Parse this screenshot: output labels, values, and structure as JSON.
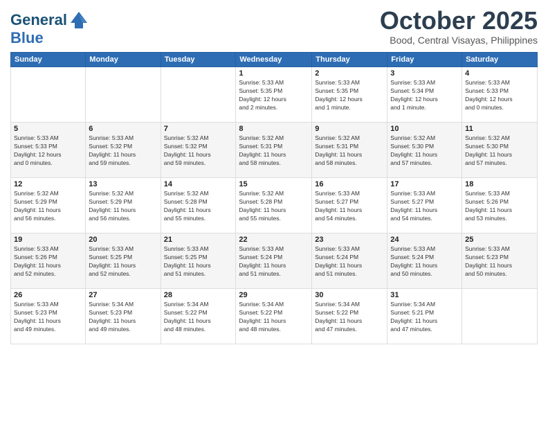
{
  "header": {
    "logo_line1": "General",
    "logo_line2": "Blue",
    "month": "October 2025",
    "location": "Bood, Central Visayas, Philippines"
  },
  "weekdays": [
    "Sunday",
    "Monday",
    "Tuesday",
    "Wednesday",
    "Thursday",
    "Friday",
    "Saturday"
  ],
  "weeks": [
    [
      {
        "day": "",
        "text": ""
      },
      {
        "day": "",
        "text": ""
      },
      {
        "day": "",
        "text": ""
      },
      {
        "day": "1",
        "text": "Sunrise: 5:33 AM\nSunset: 5:35 PM\nDaylight: 12 hours\nand 2 minutes."
      },
      {
        "day": "2",
        "text": "Sunrise: 5:33 AM\nSunset: 5:35 PM\nDaylight: 12 hours\nand 1 minute."
      },
      {
        "day": "3",
        "text": "Sunrise: 5:33 AM\nSunset: 5:34 PM\nDaylight: 12 hours\nand 1 minute."
      },
      {
        "day": "4",
        "text": "Sunrise: 5:33 AM\nSunset: 5:33 PM\nDaylight: 12 hours\nand 0 minutes."
      }
    ],
    [
      {
        "day": "5",
        "text": "Sunrise: 5:33 AM\nSunset: 5:33 PM\nDaylight: 12 hours\nand 0 minutes."
      },
      {
        "day": "6",
        "text": "Sunrise: 5:33 AM\nSunset: 5:32 PM\nDaylight: 11 hours\nand 59 minutes."
      },
      {
        "day": "7",
        "text": "Sunrise: 5:32 AM\nSunset: 5:32 PM\nDaylight: 11 hours\nand 59 minutes."
      },
      {
        "day": "8",
        "text": "Sunrise: 5:32 AM\nSunset: 5:31 PM\nDaylight: 11 hours\nand 58 minutes."
      },
      {
        "day": "9",
        "text": "Sunrise: 5:32 AM\nSunset: 5:31 PM\nDaylight: 11 hours\nand 58 minutes."
      },
      {
        "day": "10",
        "text": "Sunrise: 5:32 AM\nSunset: 5:30 PM\nDaylight: 11 hours\nand 57 minutes."
      },
      {
        "day": "11",
        "text": "Sunrise: 5:32 AM\nSunset: 5:30 PM\nDaylight: 11 hours\nand 57 minutes."
      }
    ],
    [
      {
        "day": "12",
        "text": "Sunrise: 5:32 AM\nSunset: 5:29 PM\nDaylight: 11 hours\nand 56 minutes."
      },
      {
        "day": "13",
        "text": "Sunrise: 5:32 AM\nSunset: 5:29 PM\nDaylight: 11 hours\nand 56 minutes."
      },
      {
        "day": "14",
        "text": "Sunrise: 5:32 AM\nSunset: 5:28 PM\nDaylight: 11 hours\nand 55 minutes."
      },
      {
        "day": "15",
        "text": "Sunrise: 5:32 AM\nSunset: 5:28 PM\nDaylight: 11 hours\nand 55 minutes."
      },
      {
        "day": "16",
        "text": "Sunrise: 5:33 AM\nSunset: 5:27 PM\nDaylight: 11 hours\nand 54 minutes."
      },
      {
        "day": "17",
        "text": "Sunrise: 5:33 AM\nSunset: 5:27 PM\nDaylight: 11 hours\nand 54 minutes."
      },
      {
        "day": "18",
        "text": "Sunrise: 5:33 AM\nSunset: 5:26 PM\nDaylight: 11 hours\nand 53 minutes."
      }
    ],
    [
      {
        "day": "19",
        "text": "Sunrise: 5:33 AM\nSunset: 5:26 PM\nDaylight: 11 hours\nand 52 minutes."
      },
      {
        "day": "20",
        "text": "Sunrise: 5:33 AM\nSunset: 5:25 PM\nDaylight: 11 hours\nand 52 minutes."
      },
      {
        "day": "21",
        "text": "Sunrise: 5:33 AM\nSunset: 5:25 PM\nDaylight: 11 hours\nand 51 minutes."
      },
      {
        "day": "22",
        "text": "Sunrise: 5:33 AM\nSunset: 5:24 PM\nDaylight: 11 hours\nand 51 minutes."
      },
      {
        "day": "23",
        "text": "Sunrise: 5:33 AM\nSunset: 5:24 PM\nDaylight: 11 hours\nand 51 minutes."
      },
      {
        "day": "24",
        "text": "Sunrise: 5:33 AM\nSunset: 5:24 PM\nDaylight: 11 hours\nand 50 minutes."
      },
      {
        "day": "25",
        "text": "Sunrise: 5:33 AM\nSunset: 5:23 PM\nDaylight: 11 hours\nand 50 minutes."
      }
    ],
    [
      {
        "day": "26",
        "text": "Sunrise: 5:33 AM\nSunset: 5:23 PM\nDaylight: 11 hours\nand 49 minutes."
      },
      {
        "day": "27",
        "text": "Sunrise: 5:34 AM\nSunset: 5:23 PM\nDaylight: 11 hours\nand 49 minutes."
      },
      {
        "day": "28",
        "text": "Sunrise: 5:34 AM\nSunset: 5:22 PM\nDaylight: 11 hours\nand 48 minutes."
      },
      {
        "day": "29",
        "text": "Sunrise: 5:34 AM\nSunset: 5:22 PM\nDaylight: 11 hours\nand 48 minutes."
      },
      {
        "day": "30",
        "text": "Sunrise: 5:34 AM\nSunset: 5:22 PM\nDaylight: 11 hours\nand 47 minutes."
      },
      {
        "day": "31",
        "text": "Sunrise: 5:34 AM\nSunset: 5:21 PM\nDaylight: 11 hours\nand 47 minutes."
      },
      {
        "day": "",
        "text": ""
      }
    ]
  ]
}
